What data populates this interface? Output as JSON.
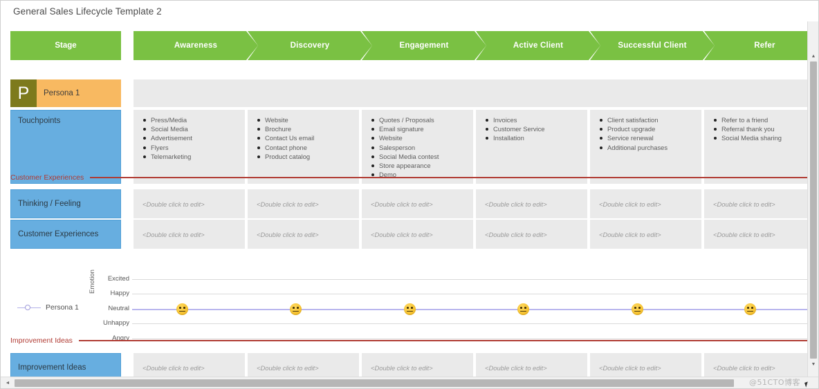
{
  "window": {
    "title": "General Sales Lifecycle Template 2"
  },
  "stages": {
    "header_label": "Stage",
    "items": [
      {
        "label": "Awareness"
      },
      {
        "label": "Discovery"
      },
      {
        "label": "Engagement"
      },
      {
        "label": "Active Client"
      },
      {
        "label": "Successful Client"
      },
      {
        "label": "Refer"
      }
    ]
  },
  "persona": {
    "badge": "P",
    "name": "Persona 1"
  },
  "touchpoints": {
    "label": "Touchpoints",
    "columns": [
      {
        "items": [
          "Press/Media",
          "Social Media",
          "Advertisement",
          "Flyers",
          "Telemarketing"
        ]
      },
      {
        "items": [
          "Website",
          "Brochure",
          "Contact Us email",
          "Contact phone",
          "Product catalog"
        ]
      },
      {
        "items": [
          "Quotes / Proposals",
          "Email signature",
          "Website",
          "Salesperson",
          "Social Media contest",
          "Store appearance",
          "Demo"
        ]
      },
      {
        "items": [
          "Invoices",
          "Customer Service",
          "Installation"
        ]
      },
      {
        "items": [
          "Client satisfaction",
          "Product upgrade",
          "Service renewal",
          "Additional purchases"
        ]
      },
      {
        "items": [
          "Refer to a friend",
          "Referral thank you",
          "Social Media sharing"
        ]
      }
    ]
  },
  "sections": {
    "customer_experiences": "Customer Experiences",
    "improvement_ideas": "Improvement Ideas"
  },
  "placeholder": "<Double click to edit>",
  "rows": [
    {
      "label": "Thinking / Feeling"
    },
    {
      "label": "Customer Experiences"
    }
  ],
  "improvement_row": {
    "label": "Improvement Ideas"
  },
  "emotion_chart": {
    "legend_label": "Persona 1",
    "axis_title": "Emotion",
    "ticks": [
      "Excited",
      "Happy",
      "Neutral",
      "Unhappy",
      "Angry"
    ],
    "points": [
      "Neutral",
      "Neutral",
      "Neutral",
      "Neutral",
      "Neutral",
      "Neutral"
    ],
    "line_color": "#b9b6ee"
  },
  "chart_data": {
    "type": "line",
    "title": "Emotion",
    "xlabel": "",
    "ylabel": "Emotion",
    "categories": [
      "Awareness",
      "Discovery",
      "Engagement",
      "Active Client",
      "Successful Client",
      "Refer"
    ],
    "ytick_labels": [
      "Excited",
      "Happy",
      "Neutral",
      "Unhappy",
      "Angry"
    ],
    "series": [
      {
        "name": "Persona 1",
        "values": [
          "Neutral",
          "Neutral",
          "Neutral",
          "Neutral",
          "Neutral",
          "Neutral"
        ]
      }
    ],
    "grid": true,
    "legend_position": "left"
  },
  "colors": {
    "stage_green": "#7ac143",
    "label_blue": "#67aee0",
    "persona_orange": "#f8b961",
    "persona_badge": "#7d7a1c",
    "section_red": "#b03a32",
    "cell_gray": "#eaeaea"
  },
  "watermark": "@51CTO博客",
  "scrollbars": {
    "v_arrow_up": "▲",
    "v_arrow_down": "▼",
    "h_arrow_left": "◄"
  }
}
